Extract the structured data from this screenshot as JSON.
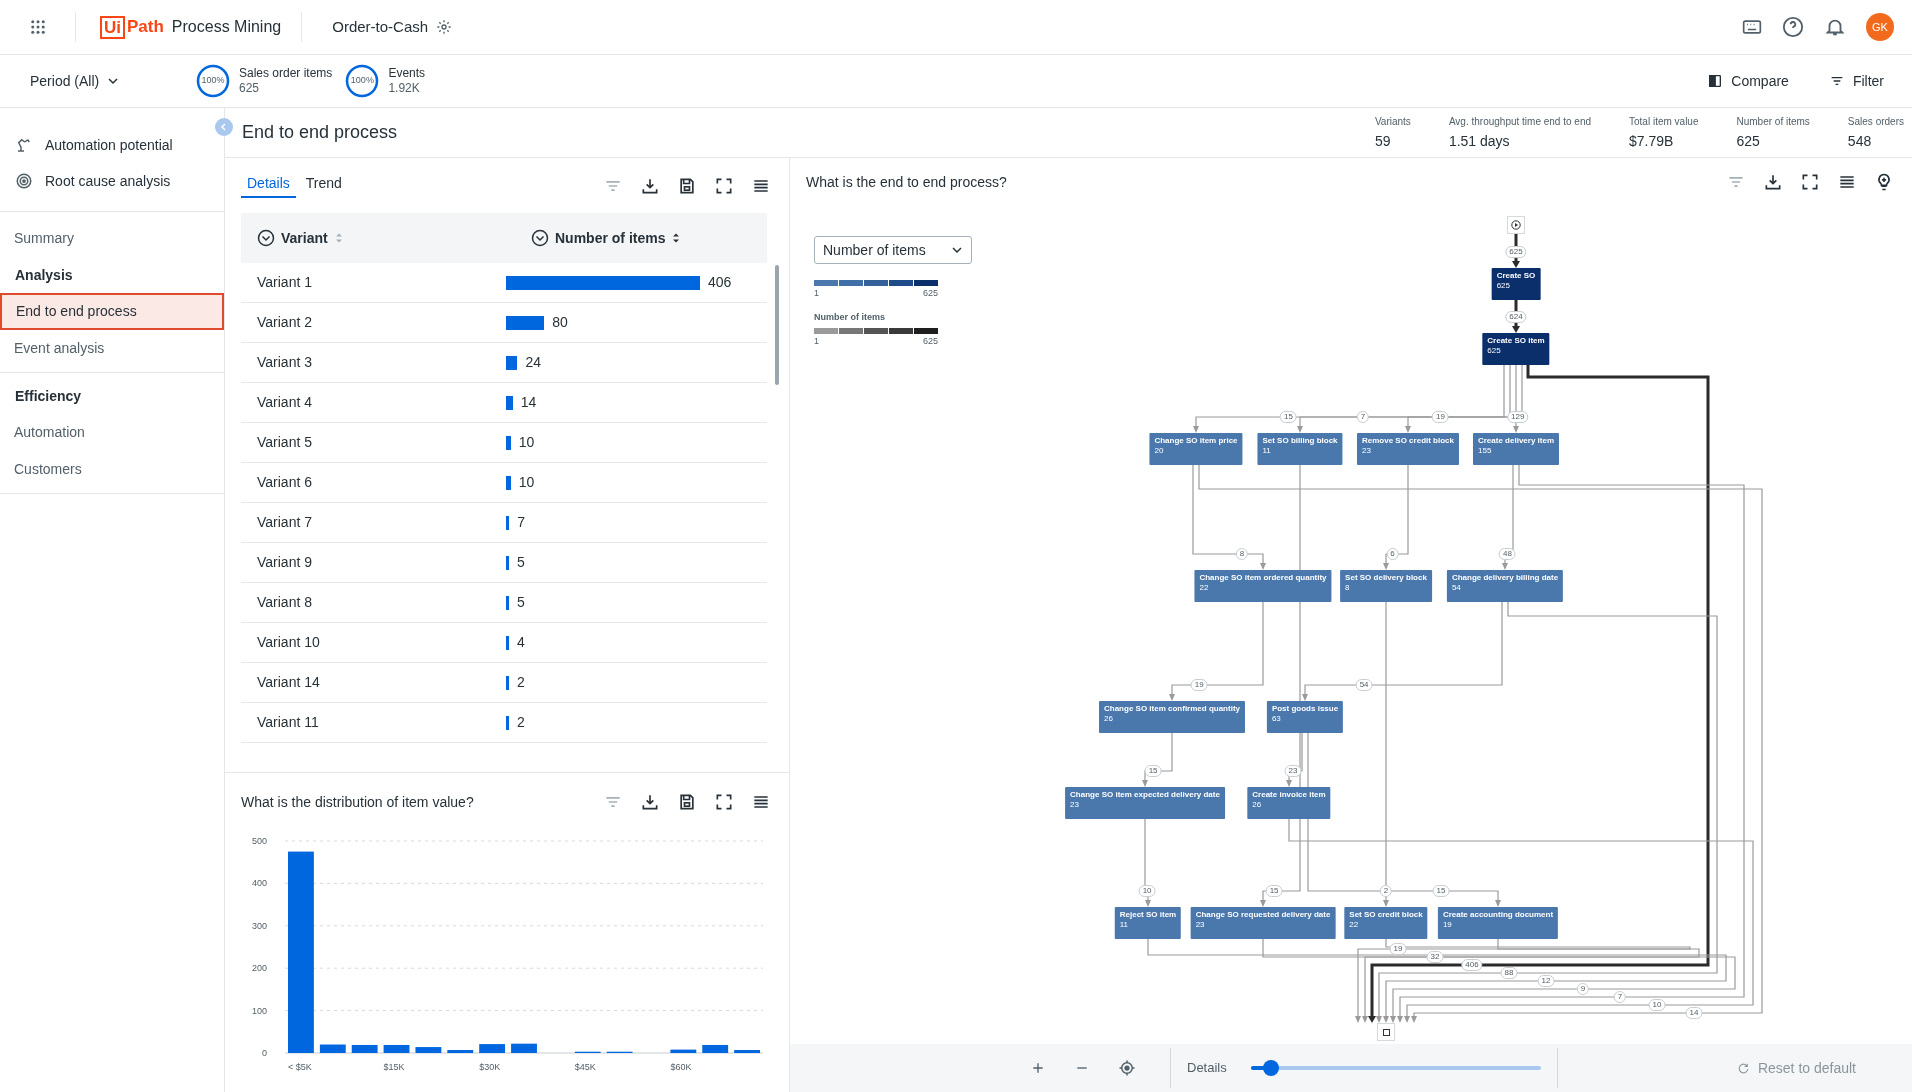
{
  "app": {
    "logo_mark": "Ui",
    "logo_text": "Path",
    "product": "Process Mining",
    "process": "Order-to-Cash",
    "avatar": "GK"
  },
  "filter_bar": {
    "period": "Period (All)",
    "metrics": [
      {
        "percent": "100%",
        "label": "Sales order items",
        "value": "625",
        "level": 1
      },
      {
        "percent": "100%",
        "label": "Events",
        "value": "1.92K",
        "level": 1
      }
    ],
    "actions": [
      "Compare",
      "Filter"
    ]
  },
  "sidebar": {
    "tools": [
      {
        "label": "Automation potential"
      },
      {
        "label": "Root cause analysis"
      }
    ],
    "nav": [
      {
        "kind": "link",
        "label": "Summary",
        "selected": false
      },
      {
        "kind": "header",
        "label": "Analysis"
      },
      {
        "kind": "link",
        "label": "End to end process",
        "selected": true
      },
      {
        "kind": "link",
        "label": "Event analysis",
        "selected": false
      },
      {
        "kind": "header",
        "label": "Efficiency"
      },
      {
        "kind": "link",
        "label": "Automation",
        "selected": false
      },
      {
        "kind": "link",
        "label": "Customers",
        "selected": false
      }
    ]
  },
  "page": {
    "title": "End to end process",
    "kpis": [
      {
        "label": "Variants",
        "value": "59"
      },
      {
        "label": "Avg. throughput time end to end",
        "value": "1.51 days"
      },
      {
        "label": "Total item value",
        "value": "$7.79B"
      },
      {
        "label": "Number of items",
        "value": "625"
      },
      {
        "label": "Sales orders",
        "value": "548"
      }
    ]
  },
  "variants_panel": {
    "tabs": [
      {
        "label": "Details",
        "selected": true
      },
      {
        "label": "Trend",
        "selected": false
      }
    ],
    "columns": [
      "Variant",
      "Number of items"
    ],
    "rows": [
      {
        "variant": "Variant 1",
        "items": "406"
      },
      {
        "variant": "Variant 2",
        "items": "80"
      },
      {
        "variant": "Variant 3",
        "items": "24"
      },
      {
        "variant": "Variant 4",
        "items": "14"
      },
      {
        "variant": "Variant 5",
        "items": "10"
      },
      {
        "variant": "Variant 6",
        "items": "10"
      },
      {
        "variant": "Variant 7",
        "items": "7"
      },
      {
        "variant": "Variant 9",
        "items": "5"
      },
      {
        "variant": "Variant 8",
        "items": "5"
      },
      {
        "variant": "Variant 10",
        "items": "4"
      },
      {
        "variant": "Variant 14",
        "items": "2"
      },
      {
        "variant": "Variant 11",
        "items": "2"
      }
    ]
  },
  "distribution_panel": {
    "title": "What is the distribution of item value?",
    "chart_data": {
      "type": "bar",
      "categories": [
        "< $5K",
        null,
        null,
        "$15K",
        null,
        null,
        "$30K",
        null,
        null,
        "$45K",
        null,
        null,
        "$60K",
        null,
        null
      ],
      "values": [
        475,
        20,
        19,
        19,
        14,
        7,
        21,
        22,
        0,
        3,
        3,
        0,
        8,
        19,
        7
      ],
      "ylim": [
        0,
        500
      ],
      "yticks": [
        0,
        100,
        200,
        300,
        400,
        500
      ],
      "grid": true
    }
  },
  "process_map": {
    "title": "What is the end to end process?",
    "measure": "Number of items",
    "legends": [
      {
        "kind": "nodes",
        "min": "1",
        "max": "625"
      },
      {
        "kind": "edges",
        "title": "Number of items",
        "min": "1",
        "max": "625"
      }
    ],
    "nodes": [
      {
        "kind": "start"
      },
      {
        "kind": "activity",
        "name": "Create SO",
        "count": "625",
        "color": "#0b2f6b"
      },
      {
        "kind": "activity",
        "name": "Create SO item",
        "count": "625",
        "color": "#0b2f6b"
      },
      {
        "kind": "activity",
        "name": "Change SO item price",
        "count": "20",
        "color": "#4a78ad"
      },
      {
        "kind": "activity",
        "name": "Set SO billing block",
        "count": "11",
        "color": "#4a78ad"
      },
      {
        "kind": "activity",
        "name": "Remove SO credit block",
        "count": "23",
        "color": "#4a78ad"
      },
      {
        "kind": "activity",
        "name": "Create delivery item",
        "count": "155",
        "color": "#4a78ad"
      },
      {
        "kind": "activity",
        "name": "Change SO item ordered quantity",
        "count": "22",
        "color": "#4a78ad"
      },
      {
        "kind": "activity",
        "name": "Set SO delivery block",
        "count": "8",
        "color": "#4a78ad"
      },
      {
        "kind": "activity",
        "name": "Change delivery billing date",
        "count": "54",
        "color": "#4a78ad"
      },
      {
        "kind": "activity",
        "name": "Change SO item confirmed quantity",
        "count": "26",
        "color": "#4a78ad"
      },
      {
        "kind": "activity",
        "name": "Post goods issue",
        "count": "63",
        "color": "#4a78ad"
      },
      {
        "kind": "activity",
        "name": "Change SO item expected delivery date",
        "count": "23",
        "color": "#4a78ad"
      },
      {
        "kind": "activity",
        "name": "Create invoice item",
        "count": "26",
        "color": "#4a78ad"
      },
      {
        "kind": "activity",
        "name": "Reject SO item",
        "count": "11",
        "color": "#4a78ad"
      },
      {
        "kind": "activity",
        "name": "Change SO requested delivery date",
        "count": "23",
        "color": "#4a78ad"
      },
      {
        "kind": "activity",
        "name": "Set SO credit block",
        "count": "22",
        "color": "#4a78ad"
      },
      {
        "kind": "activity",
        "name": "Create accounting document",
        "count": "19",
        "color": "#4a78ad"
      },
      {
        "kind": "end"
      }
    ],
    "edges": [
      {
        "label": "625",
        "heavy": true
      },
      {
        "label": "624",
        "heavy": true
      },
      {
        "label": "15",
        "heavy": false
      },
      {
        "label": "7",
        "heavy": false
      },
      {
        "label": "19",
        "heavy": false
      },
      {
        "label": "129",
        "heavy": false
      },
      {
        "label": "8",
        "heavy": false
      },
      {
        "label": "6",
        "heavy": false
      },
      {
        "label": "48",
        "heavy": false
      },
      {
        "label": "19",
        "heavy": false
      },
      {
        "label": "54",
        "heavy": false
      },
      {
        "label": "15",
        "heavy": false
      },
      {
        "label": "23",
        "heavy": false
      },
      {
        "label": "10",
        "heavy": false
      },
      {
        "label": "15",
        "heavy": false
      },
      {
        "label": "2",
        "heavy": false
      },
      {
        "label": "15",
        "heavy": false
      },
      {
        "label": "19",
        "heavy": false
      },
      {
        "label": "32",
        "heavy": false
      },
      {
        "label": "406",
        "heavy": true
      },
      {
        "label": "88",
        "heavy": false
      },
      {
        "label": "12",
        "heavy": false
      },
      {
        "label": "9",
        "heavy": false
      },
      {
        "label": "7",
        "heavy": false
      },
      {
        "label": "10",
        "heavy": false
      },
      {
        "label": "14",
        "heavy": false
      }
    ],
    "details_slider": {
      "label": "Details",
      "level": 0.07
    },
    "reset": "Reset to default"
  }
}
